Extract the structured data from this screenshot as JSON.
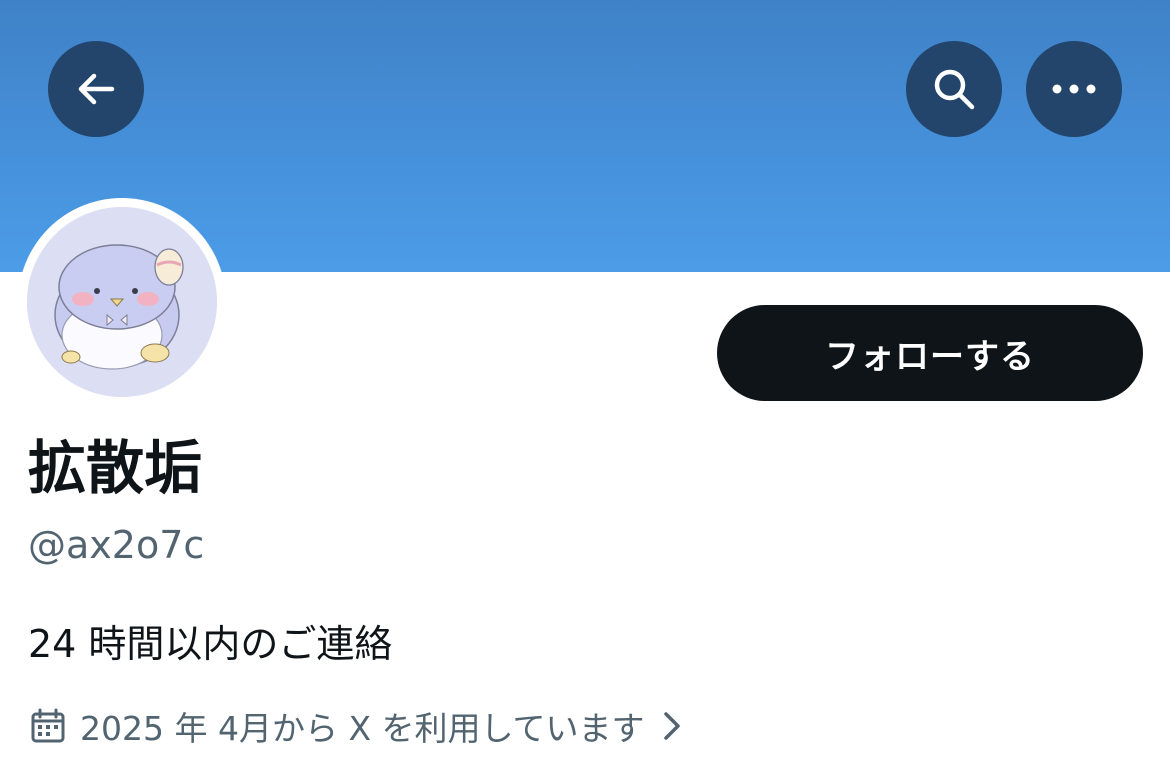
{
  "header": {
    "back_icon": "arrow-left-icon",
    "search_icon": "search-icon",
    "more_icon": "more-horizontal-icon",
    "banner_color": "#4690da",
    "button_color": "#23456b"
  },
  "profile": {
    "avatar_icon": "penguin-avatar",
    "display_name": "拡散垢",
    "handle": "@ax2o7c",
    "bio": "24 時間以内のご連絡",
    "joined": "2025 年 4月から X を利用しています",
    "joined_icon": "calendar-icon",
    "joined_chevron_icon": "chevron-right-icon"
  },
  "actions": {
    "follow_label": "フォローする",
    "follow_bg": "#0f1419"
  }
}
